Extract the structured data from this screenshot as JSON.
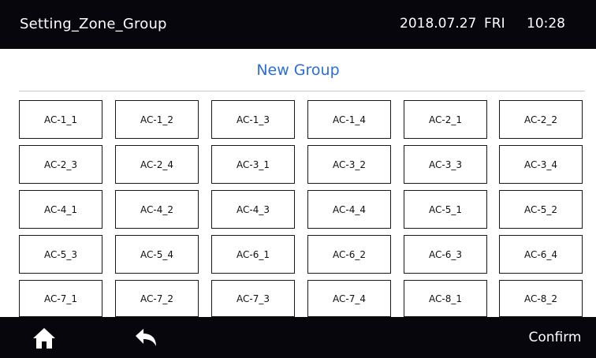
{
  "header": {
    "title": "Setting_Zone_Group",
    "date": "2018.07.27",
    "weekday": "FRI",
    "time": "10:28"
  },
  "main": {
    "heading": "New Group",
    "zones": [
      "AC-1_1",
      "AC-1_2",
      "AC-1_3",
      "AC-1_4",
      "AC-2_1",
      "AC-2_2",
      "AC-2_3",
      "AC-2_4",
      "AC-3_1",
      "AC-3_2",
      "AC-3_3",
      "AC-3_4",
      "AC-4_1",
      "AC-4_2",
      "AC-4_3",
      "AC-4_4",
      "AC-5_1",
      "AC-5_2",
      "AC-5_3",
      "AC-5_4",
      "AC-6_1",
      "AC-6_2",
      "AC-6_3",
      "AC-6_4",
      "AC-7_1",
      "AC-7_2",
      "AC-7_3",
      "AC-7_4",
      "AC-8_1",
      "AC-8_2"
    ]
  },
  "footer": {
    "home_icon": "home-icon",
    "back_icon": "back-arrow-icon",
    "confirm_label": "Confirm"
  }
}
